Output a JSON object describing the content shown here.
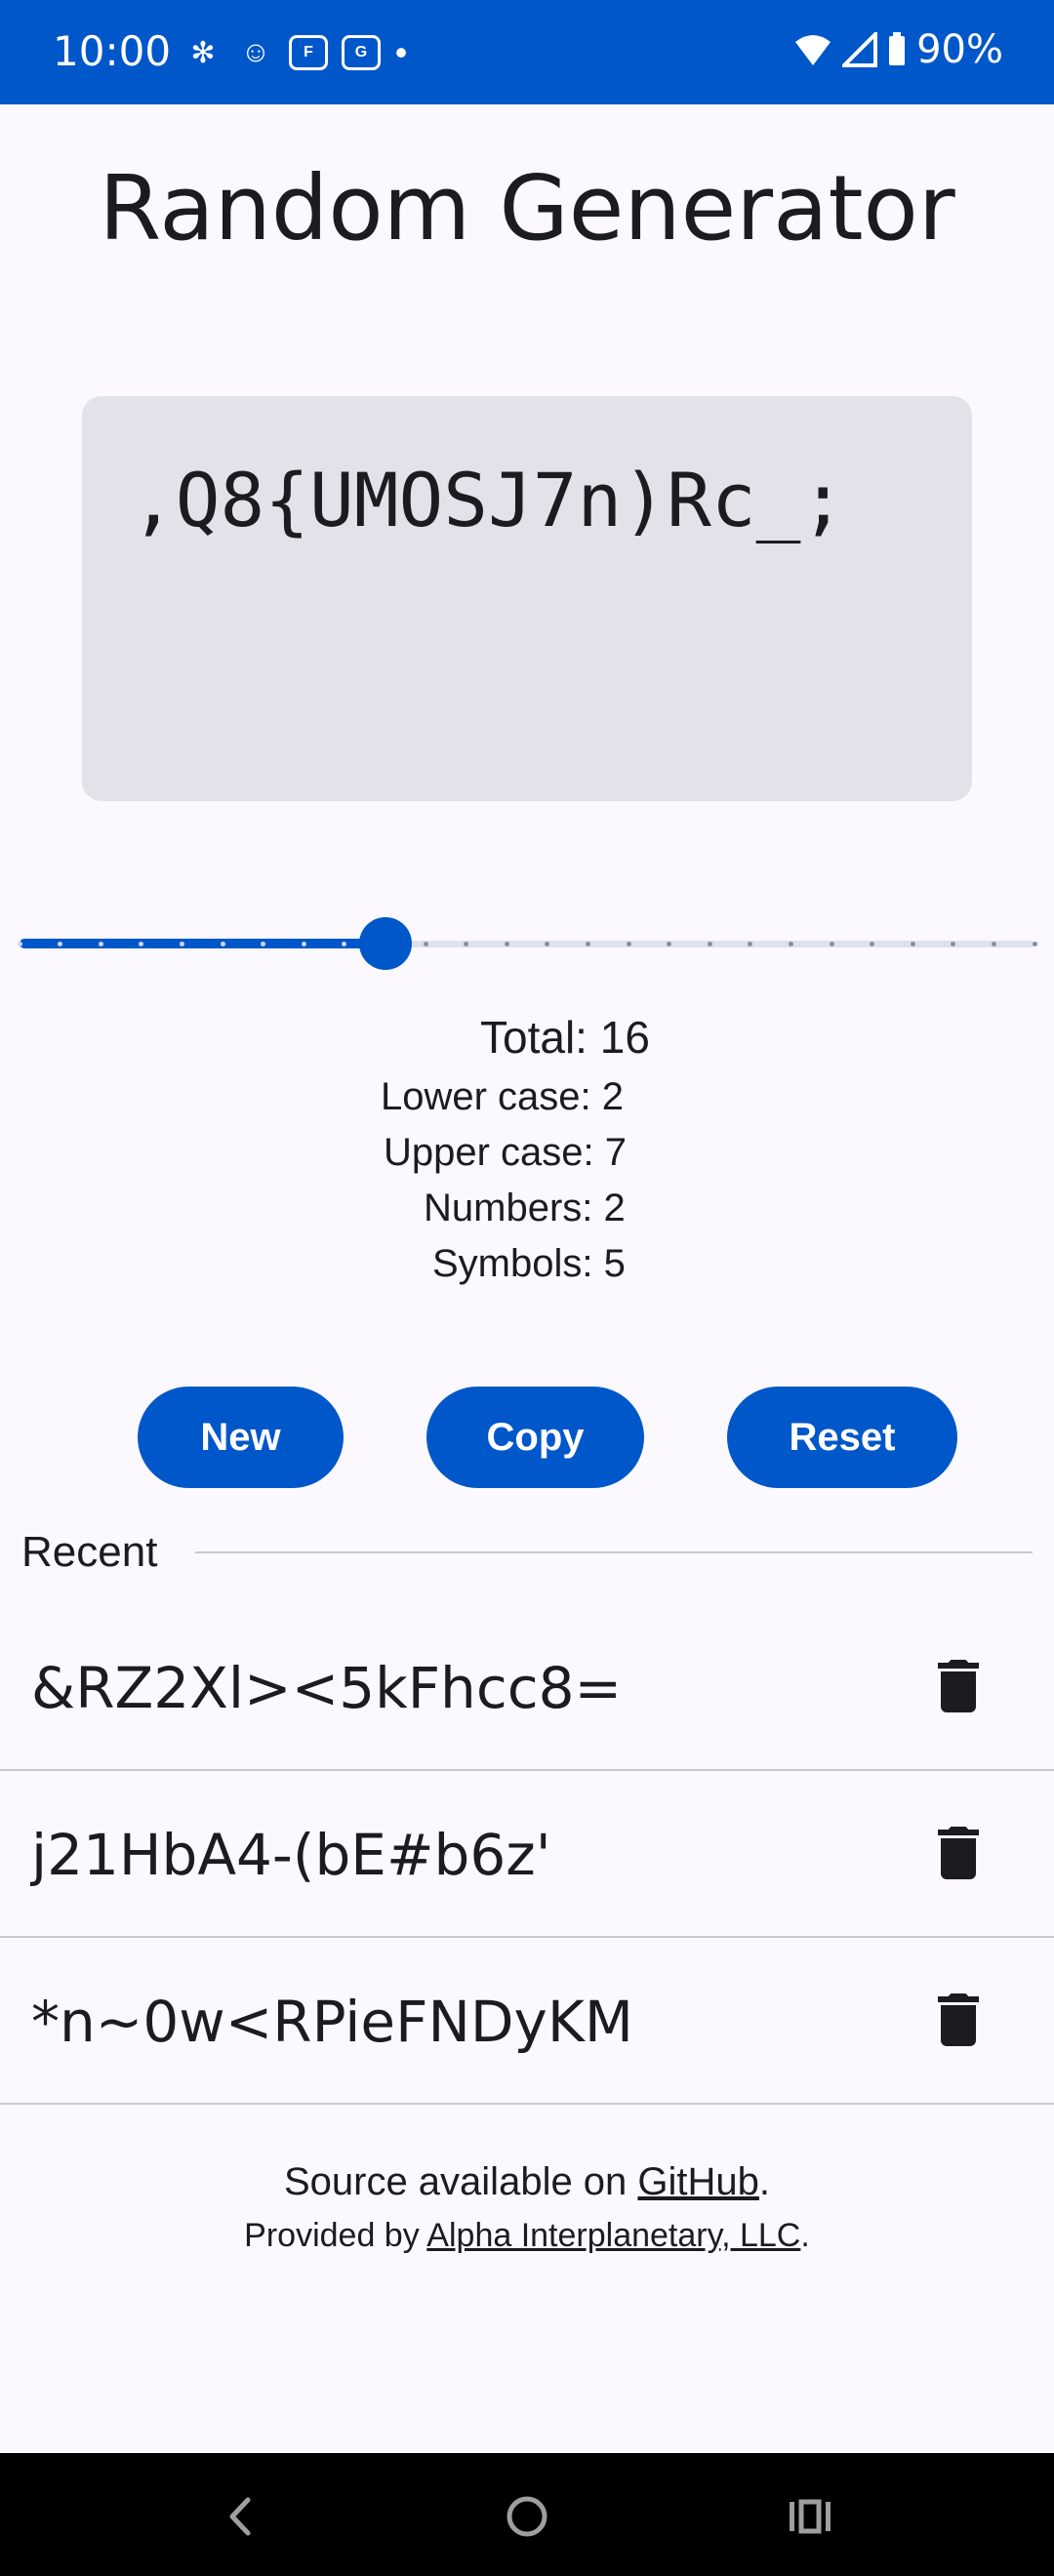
{
  "status_bar": {
    "time": "10:00",
    "battery": "90%",
    "notification_icons": [
      "slack-icon",
      "robot-icon",
      "ford-icon",
      "ge-icon",
      "dot-icon"
    ],
    "color": "#0057c9"
  },
  "title": "Random Generator",
  "generated_password": ",Q8{UMOSJ7n)Rc_;",
  "slider": {
    "value": 16,
    "min": 7,
    "max": 32,
    "active_color": "#0057c9"
  },
  "stats": {
    "total_label": "Total:",
    "total_value": "16",
    "lower_label": "Lower case:",
    "lower_value": "2",
    "upper_label": "Upper case:",
    "upper_value": "7",
    "numbers_label": "Numbers:",
    "numbers_value": "2",
    "symbols_label": "Symbols:",
    "symbols_value": "5"
  },
  "buttons": {
    "new": "New",
    "copy": "Copy",
    "reset": "Reset"
  },
  "recent": {
    "label": "Recent",
    "items": [
      {
        "text": "&RZ2Xl><5kFhcc8=",
        "icon": "trash-icon"
      },
      {
        "text": "j21HbA4-(bE#b6z'",
        "icon": "trash-icon"
      },
      {
        "text": "*n~0w<RPieFNDyKM",
        "icon": "trash-icon"
      }
    ]
  },
  "footer": {
    "line1_prefix": "Source available on ",
    "line1_link": "GitHub",
    "line1_suffix": ".",
    "line2_prefix": "Provided by ",
    "line2_link": "Alpha Interplanetary, LLC",
    "line2_suffix": "."
  },
  "nav": {
    "back": "back-icon",
    "home": "home-icon",
    "recents": "recents-icon"
  }
}
